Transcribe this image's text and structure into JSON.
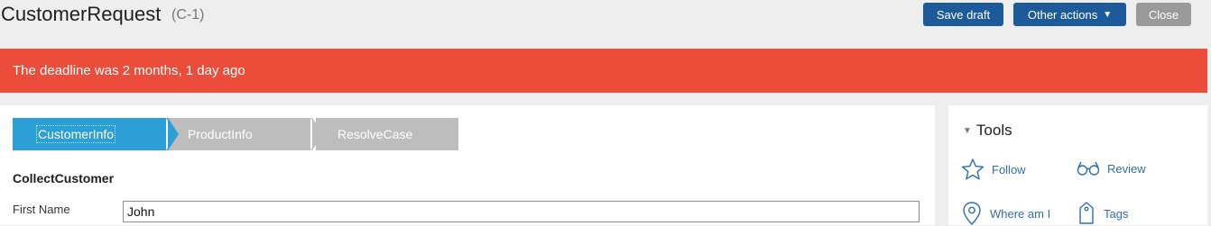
{
  "header": {
    "title": "CustomerRequest",
    "case_id": "(C-1)",
    "save_draft_label": "Save draft",
    "other_actions_label": "Other actions",
    "close_label": "Close"
  },
  "banner": {
    "text": "The deadline was 2 months, 1 day ago",
    "color": "#ea4e3a"
  },
  "stages": [
    {
      "label": "CustomerInfo",
      "active": true
    },
    {
      "label": "ProductInfo",
      "active": false
    },
    {
      "label": "ResolveCase",
      "active": false
    }
  ],
  "form": {
    "section_title": "CollectCustomer",
    "first_name_label": "First Name",
    "first_name_value": "John"
  },
  "tools": {
    "title": "Tools",
    "items": [
      {
        "label": "Follow",
        "icon": "star-icon"
      },
      {
        "label": "Review",
        "icon": "glasses-icon"
      },
      {
        "label": "Where am I",
        "icon": "location-pin-icon"
      },
      {
        "label": "Tags",
        "icon": "tag-icon"
      }
    ]
  },
  "colors": {
    "primary_button": "#1d5a99",
    "active_stage": "#2c9fd6",
    "inactive_stage": "#bdbdbd",
    "link": "#2f6ea8"
  }
}
